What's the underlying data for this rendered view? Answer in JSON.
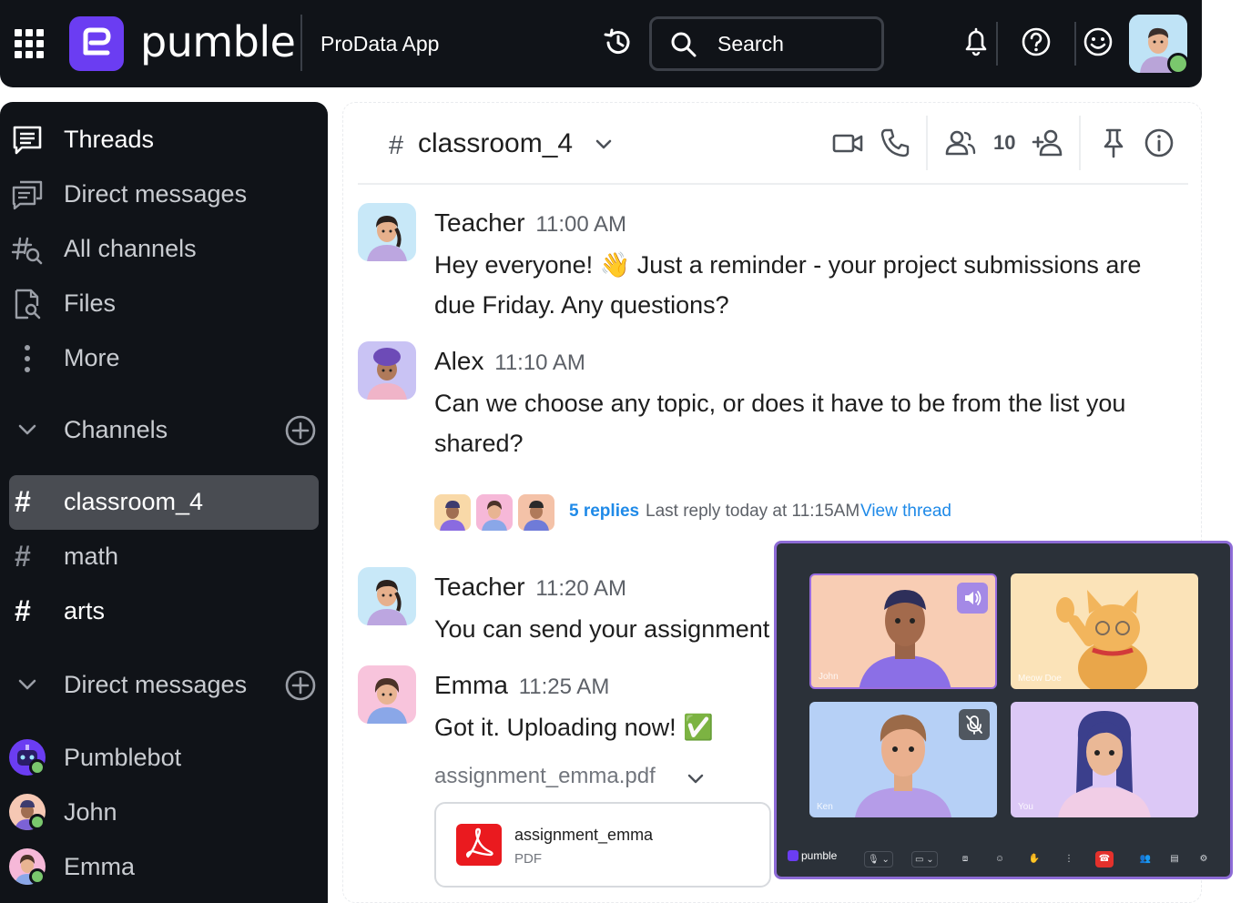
{
  "topbar": {
    "brand": "pumble",
    "workspace": "ProData App",
    "search_placeholder": "Search",
    "icons": [
      "apps-grid-icon",
      "history-icon",
      "search-icon",
      "bell-icon",
      "help-icon",
      "emoji-icon"
    ],
    "accent_color": "#6b3df2",
    "presence_color": "#7ac76d"
  },
  "sidebar": {
    "nav": [
      {
        "label": "Threads",
        "icon": "threads-icon"
      },
      {
        "label": "Direct messages",
        "icon": "direct-messages-icon"
      },
      {
        "label": "All channels",
        "icon": "channel-search-icon"
      },
      {
        "label": "Files",
        "icon": "files-icon"
      },
      {
        "label": "More",
        "icon": "more-vertical-icon"
      }
    ],
    "channels_header": "Channels",
    "channels": [
      {
        "label": "classroom_4",
        "state": "active"
      },
      {
        "label": "math",
        "state": "read"
      },
      {
        "label": "arts",
        "state": "unread"
      }
    ],
    "dm_header": "Direct messages",
    "dms": [
      {
        "label": "Pumblebot",
        "status": "online"
      },
      {
        "label": "John",
        "status": "online"
      },
      {
        "label": "Emma",
        "status": "online"
      }
    ]
  },
  "channel": {
    "hash": "#",
    "name": "classroom_4",
    "member_count": "10",
    "icons": [
      "video-icon",
      "phone-icon",
      "members-icon",
      "add-member-icon",
      "pin-icon",
      "info-icon"
    ]
  },
  "messages": [
    {
      "author": "Teacher",
      "time": "11:00 AM",
      "lines": [
        "Hey everyone! 👋 Just a reminder - your project submissions are",
        "due Friday. Any questions?"
      ]
    },
    {
      "author": "Alex",
      "time": "11:10 AM",
      "lines": [
        "Can we choose any topic, or does it have to be from the list you",
        "shared?"
      ]
    },
    {
      "author": "Teacher",
      "time": "11:20 AM",
      "lines": [
        "You can send your assignment"
      ]
    },
    {
      "author": "Emma",
      "time": "11:25 AM",
      "lines": [
        "Got it. Uploading now! ✅"
      ]
    }
  ],
  "thread": {
    "replies": "5 replies",
    "last_reply": "Last reply today at 11:15AM",
    "view": "View thread"
  },
  "attachment": {
    "filename": "assignment_emma.pdf",
    "card_name": "assignment_emma",
    "card_type": "PDF"
  },
  "call": {
    "brand": "pumble",
    "participants": [
      {
        "name": "John",
        "speaking": true,
        "badge": "speaker-icon"
      },
      {
        "name": "Meow Doe",
        "speaking": false,
        "badge": ""
      },
      {
        "name": "Ken",
        "speaking": false,
        "badge": "mic-muted-icon"
      },
      {
        "name": "You",
        "speaking": false,
        "badge": ""
      }
    ],
    "controls": [
      "mic-icon",
      "camera-icon",
      "screen-share-icon",
      "reaction-icon",
      "raise-hand-icon",
      "more-icon",
      "hang-up-icon",
      "participants-icon",
      "chat-icon",
      "settings-icon"
    ],
    "border_color": "#8d6bd6",
    "hangup_color": "#e4312c"
  }
}
